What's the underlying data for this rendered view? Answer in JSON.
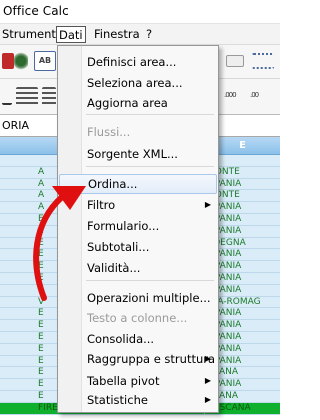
{
  "window": {
    "title": "Office Calc"
  },
  "menubar": {
    "items": [
      "Strumenti",
      "Dati",
      "Finestra",
      "?"
    ]
  },
  "namebox": {
    "value": "ORIA"
  },
  "sheet": {
    "col_header": "E",
    "rows": [
      {
        "left": "",
        "e": ""
      },
      {
        "left": "A",
        "e": "MONTE"
      },
      {
        "left": "A",
        "e": "MPANIA"
      },
      {
        "left": "A",
        "e": "MONTE"
      },
      {
        "left": "A",
        "e": "MPANIA"
      },
      {
        "left": "E",
        "e": "MPANIA"
      },
      {
        "left": "E",
        "e": "MPANIA"
      },
      {
        "left": "E",
        "e": "RDEGNA"
      },
      {
        "left": "E",
        "e": "MPANIA"
      },
      {
        "left": "E",
        "e": "MPANIA"
      },
      {
        "left": "E",
        "e": "MPANIA"
      },
      {
        "left": "E",
        "e": "MPANIA"
      },
      {
        "left": "V",
        "e": "ILIA-ROMAG"
      },
      {
        "left": "E",
        "e": "MPANIA"
      },
      {
        "left": "E",
        "e": "MPANIA"
      },
      {
        "left": "E",
        "e": "MPANIA"
      },
      {
        "left": "E",
        "e": "MPANIA"
      },
      {
        "left": "E",
        "e": "MPANIA"
      },
      {
        "left": "E",
        "e": "SCANA"
      },
      {
        "left": "E",
        "e": "MPANIA"
      },
      {
        "left": "E",
        "e": "SCANA"
      },
      {
        "left": "FIRENZE BANDINO",
        "e": "TOSCANA"
      }
    ]
  },
  "dropdown": {
    "items": [
      {
        "label": "Definisci area...",
        "disabled": false,
        "submenu": false
      },
      {
        "label": "Seleziona area...",
        "disabled": false,
        "submenu": false
      },
      {
        "label": "Aggiorna area",
        "disabled": false,
        "submenu": false
      },
      {
        "label": "Flussi...",
        "disabled": true,
        "submenu": false
      },
      {
        "label": "Sorgente XML...",
        "disabled": false,
        "submenu": false
      },
      {
        "label": "Ordina...",
        "disabled": false,
        "submenu": false,
        "highlighted": true
      },
      {
        "label": "Filtro",
        "disabled": false,
        "submenu": true
      },
      {
        "label": "Formulario...",
        "disabled": false,
        "submenu": false
      },
      {
        "label": "Subtotali...",
        "disabled": false,
        "submenu": false
      },
      {
        "label": "Validità...",
        "disabled": false,
        "submenu": false
      },
      {
        "label": "Operazioni multiple...",
        "disabled": false,
        "submenu": false
      },
      {
        "label": "Testo a colonne...",
        "disabled": true,
        "submenu": false
      },
      {
        "label": "Consolida...",
        "disabled": false,
        "submenu": false
      },
      {
        "label": "Raggruppa e struttura",
        "disabled": false,
        "submenu": true
      },
      {
        "label": "Tabella pivot",
        "disabled": false,
        "submenu": true
      },
      {
        "label": "Statistiche",
        "disabled": false,
        "submenu": true
      }
    ]
  },
  "colors": {
    "annotation_arrow": "#e01010",
    "sheet_text": "#1c7a2c",
    "highlight_border": "#a8c8ec"
  },
  "icons": {
    "submenu": "submenu-arrow-icon",
    "annotation": "red-pointer-arrow"
  }
}
